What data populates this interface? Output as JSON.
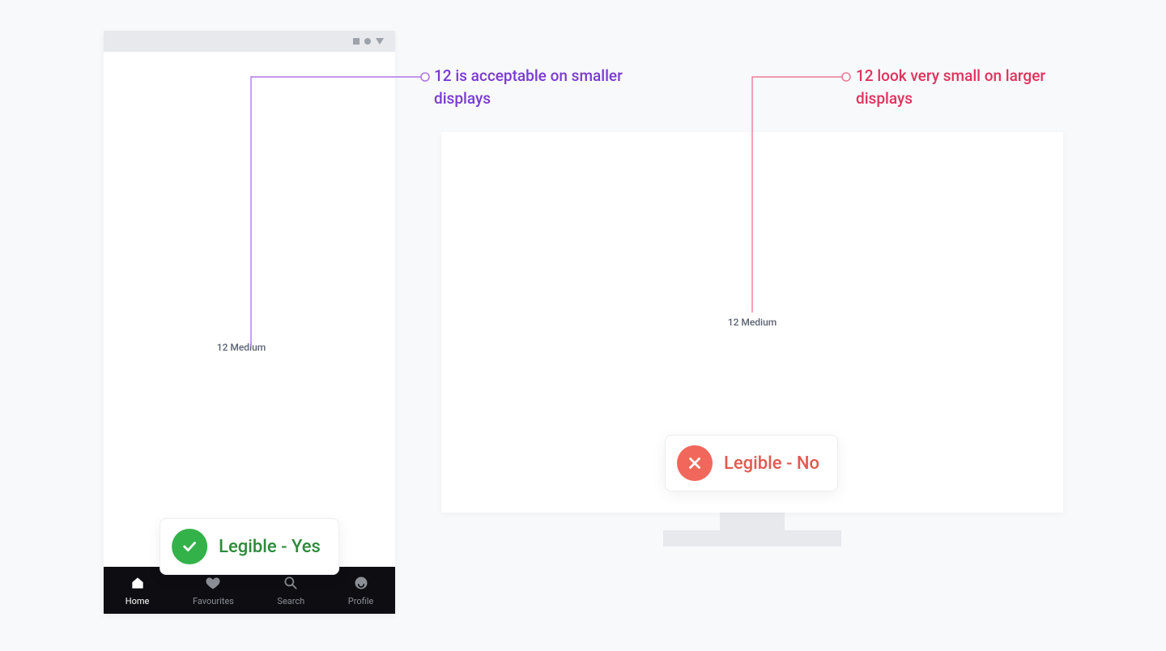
{
  "annotations": {
    "good": "12 is acceptable on smaller displays",
    "bad": "12 look very small on larger displays"
  },
  "sample_text": "12 Medium",
  "legible_yes": "Legible - Yes",
  "legible_no": "Legible - No",
  "tabbar": [
    {
      "label": "Home"
    },
    {
      "label": "Favourites"
    },
    {
      "label": "Search"
    },
    {
      "label": "Profile"
    }
  ],
  "colors": {
    "good": "#7a3bd2",
    "bad": "#e0335d",
    "good_line": "#b077e8",
    "bad_line": "#f07b99"
  }
}
